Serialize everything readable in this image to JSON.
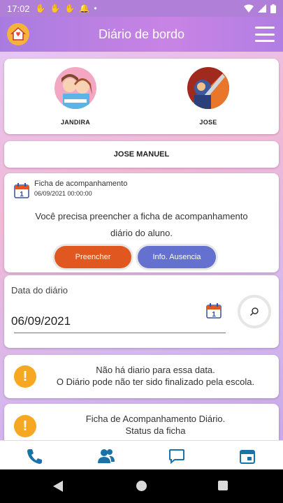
{
  "status_bar": {
    "time": "17:02"
  },
  "header": {
    "title": "Diário de bordo"
  },
  "students": [
    {
      "name": "JANDIRA"
    },
    {
      "name": "JOSE"
    }
  ],
  "selected_student": "JOSE MANUEL",
  "ficha": {
    "title": "Ficha de acompanhamento",
    "datetime": "06/09/2021 00:00:00",
    "message": "Você precisa preencher a ficha de acompanhamento diário do aluno.",
    "btn_fill": "Preencher",
    "btn_absence": "Info. Ausencia",
    "calendar_day": "1"
  },
  "diary_date": {
    "label": "Data do diário",
    "value": "06/09/2021",
    "calendar_day": "1"
  },
  "alerts": [
    {
      "line1": "Não há diario para essa data.",
      "line2": "O Diário pode não ter sido finalizado pela escola."
    },
    {
      "line1": "Ficha de Acompanhamento Diário.",
      "line2": "Status da ficha"
    }
  ],
  "colors": {
    "primary": "#a97be0",
    "fill_button": "#e0571f",
    "absence_button": "#6571cf",
    "warning": "#f7a823",
    "nav_icons": "#1a73a8"
  },
  "icons": {
    "nav": [
      "phone-icon",
      "contacts-icon",
      "chat-icon",
      "calendar-icon"
    ]
  }
}
